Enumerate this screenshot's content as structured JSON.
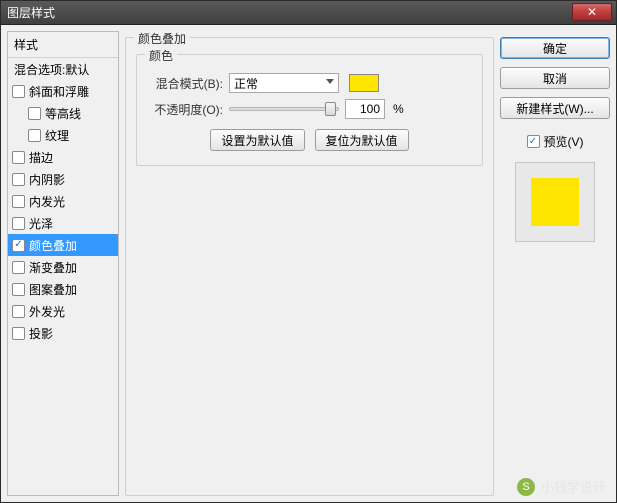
{
  "window": {
    "title": "图层样式"
  },
  "sidebar": {
    "head": "样式",
    "items": [
      {
        "label": "混合选项:默认",
        "checked": false,
        "checkbox": false,
        "indent": 0,
        "selected": false
      },
      {
        "label": "斜面和浮雕",
        "checked": false,
        "checkbox": true,
        "indent": 0,
        "selected": false
      },
      {
        "label": "等高线",
        "checked": false,
        "checkbox": true,
        "indent": 1,
        "selected": false
      },
      {
        "label": "纹理",
        "checked": false,
        "checkbox": true,
        "indent": 1,
        "selected": false
      },
      {
        "label": "描边",
        "checked": false,
        "checkbox": true,
        "indent": 0,
        "selected": false
      },
      {
        "label": "内阴影",
        "checked": false,
        "checkbox": true,
        "indent": 0,
        "selected": false
      },
      {
        "label": "内发光",
        "checked": false,
        "checkbox": true,
        "indent": 0,
        "selected": false
      },
      {
        "label": "光泽",
        "checked": false,
        "checkbox": true,
        "indent": 0,
        "selected": false
      },
      {
        "label": "颜色叠加",
        "checked": true,
        "checkbox": true,
        "indent": 0,
        "selected": true
      },
      {
        "label": "渐变叠加",
        "checked": false,
        "checkbox": true,
        "indent": 0,
        "selected": false
      },
      {
        "label": "图案叠加",
        "checked": false,
        "checkbox": true,
        "indent": 0,
        "selected": false
      },
      {
        "label": "外发光",
        "checked": false,
        "checkbox": true,
        "indent": 0,
        "selected": false
      },
      {
        "label": "投影",
        "checked": false,
        "checkbox": true,
        "indent": 0,
        "selected": false
      }
    ]
  },
  "panel": {
    "group_title": "颜色叠加",
    "subgroup_title": "颜色",
    "blend_label": "混合模式(B):",
    "blend_value": "正常",
    "swatch_color": "#ffe600",
    "opacity_label": "不透明度(O):",
    "opacity_value": "100",
    "opacity_suffix": "%",
    "opacity_pct": 100,
    "set_default": "设置为默认值",
    "reset_default": "复位为默认值"
  },
  "right": {
    "ok": "确定",
    "cancel": "取消",
    "new_style": "新建样式(W)...",
    "preview_label": "预览(V)",
    "preview_checked": true,
    "preview_fill": "#ffe600"
  },
  "watermark": {
    "icon": "S",
    "text": "小钱学设计"
  }
}
